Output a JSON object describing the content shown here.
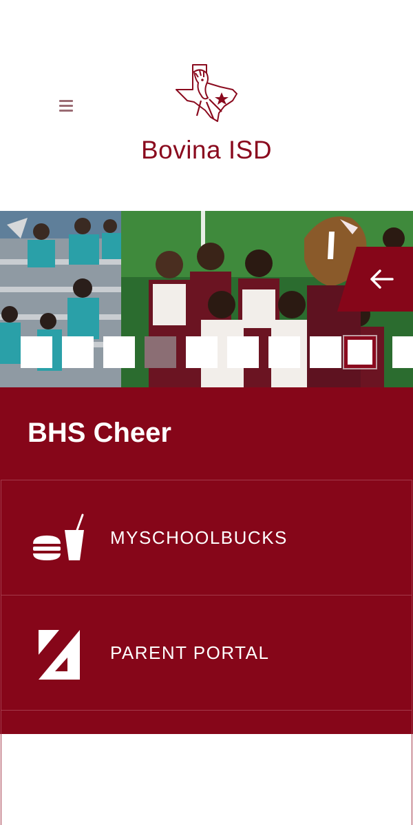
{
  "header": {
    "title": "Bovina ISD",
    "menu_icon": "hamburger-menu-icon",
    "logo_icon": "mustang-texas-logo"
  },
  "slideshow": {
    "caption": "BHS Cheer",
    "prev_icon": "arrow-left-icon",
    "slide_count": 10,
    "active_slide": 9
  },
  "quick_links": [
    {
      "label": "MYSCHOOLBUCKS",
      "icon": "food-drink-icon"
    },
    {
      "label": "PARENT PORTAL",
      "icon": "parent-portal-icon"
    }
  ],
  "colors": {
    "brand_maroon": "#860619",
    "title_maroon": "#8a0a1e",
    "menu_icon": "#9a6b73",
    "dot_muted": "#8b6e74"
  }
}
